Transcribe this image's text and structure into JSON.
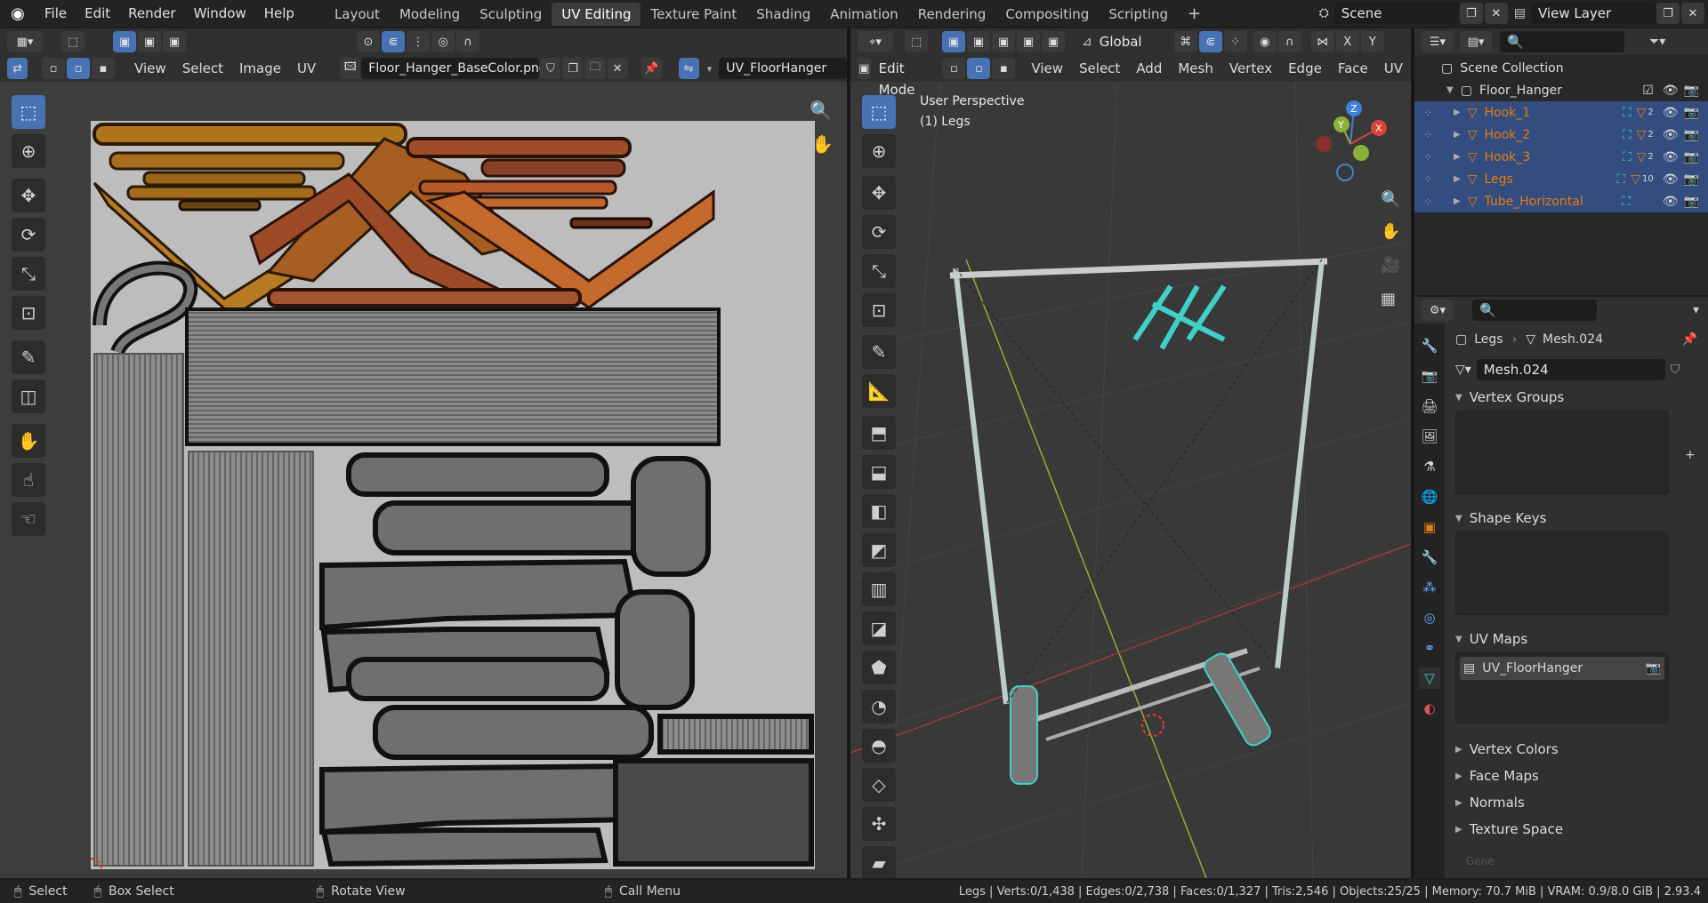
{
  "topbar": {
    "menus": [
      "File",
      "Edit",
      "Render",
      "Window",
      "Help"
    ],
    "workspaces": [
      "Layout",
      "Modeling",
      "Sculpting",
      "UV Editing",
      "Texture Paint",
      "Shading",
      "Animation",
      "Rendering",
      "Compositing",
      "Scripting"
    ],
    "active_workspace": "UV Editing",
    "scene": "Scene",
    "view_layer": "View Layer"
  },
  "uv_editor": {
    "menus": [
      "View",
      "Select",
      "Image",
      "UV"
    ],
    "image_name": "Floor_Hanger_BaseColor.png",
    "uvmap_name": "UV_FloorHanger"
  },
  "viewport": {
    "transform_orientation": "Global",
    "mode": "Edit Mode",
    "menus": [
      "View",
      "Select",
      "Add",
      "Mesh",
      "Vertex",
      "Edge",
      "Face",
      "UV"
    ],
    "perspective_label": "User Perspective",
    "object_label": "(1) Legs",
    "gizmo_axes": [
      "Z",
      "Y",
      "X"
    ]
  },
  "outliner": {
    "collection": "Scene Collection",
    "root": "Floor_Hanger",
    "items": [
      {
        "name": "Hook_1",
        "badge": "2"
      },
      {
        "name": "Hook_2",
        "badge": "2"
      },
      {
        "name": "Hook_3",
        "badge": "2"
      },
      {
        "name": "Legs",
        "badge": "10"
      },
      {
        "name": "Tube_Horizontal",
        "badge": ""
      }
    ]
  },
  "properties": {
    "object_name": "Legs",
    "mesh_name": "Mesh.024",
    "mesh_field": "Mesh.024",
    "panels": {
      "vertex_groups": "Vertex Groups",
      "shape_keys": "Shape Keys",
      "uv_maps": "UV Maps",
      "vertex_colors": "Vertex Colors",
      "face_maps": "Face Maps",
      "normals": "Normals",
      "texture_space": "Texture Space"
    },
    "uv_map_item": "UV_FloorHanger",
    "faded_text": "Gene"
  },
  "statusbar": {
    "select": "Select",
    "box_select": "Box Select",
    "rotate_view": "Rotate View",
    "call_menu": "Call Menu",
    "stats": "Legs | Verts:0/1,438 | Edges:0/2,738 | Faces:0/1,327 | Tris:2,546 | Objects:25/25 | Memory: 70.7 MiB | VRAM: 0.9/8.0 GiB | 2.93.4"
  },
  "colors": {
    "accent": "#4772b3",
    "object_orange": "#e87d0d",
    "mesh_green": "#3fd0c8",
    "background": "#1d1d1d"
  }
}
